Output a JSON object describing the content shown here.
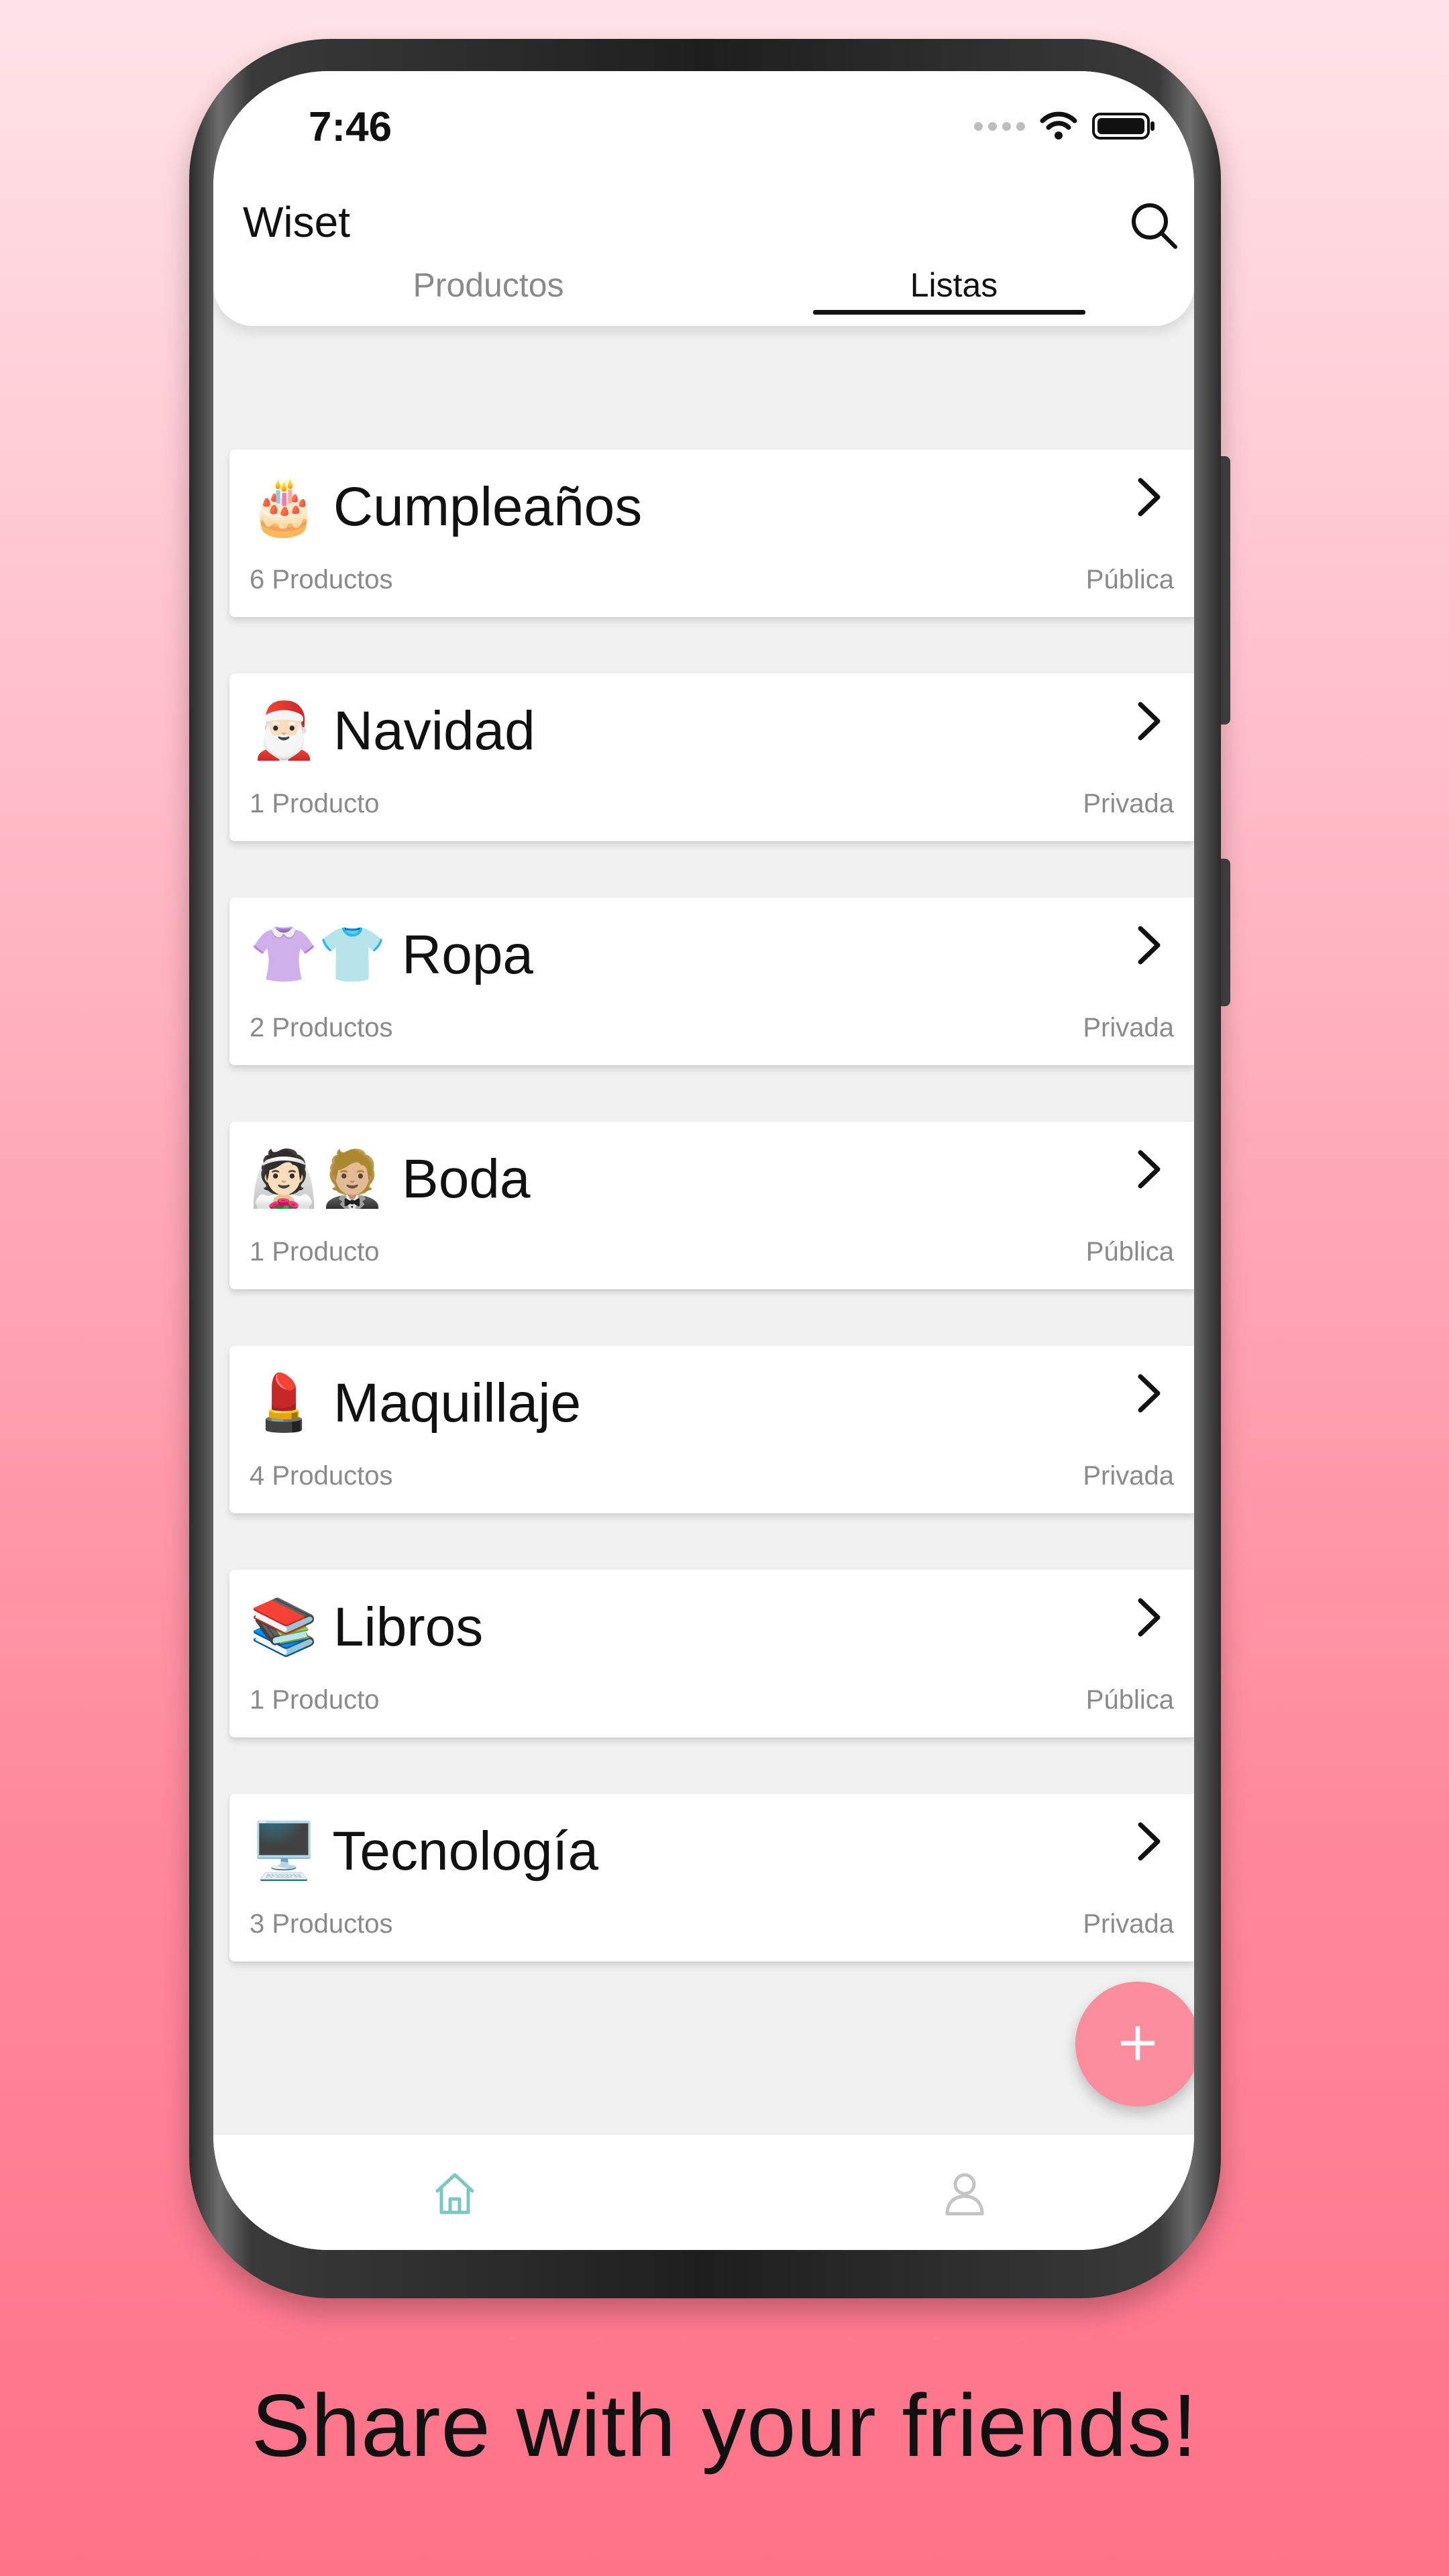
{
  "status_bar": {
    "time": "7:46"
  },
  "app": {
    "title": "Wiset",
    "tabs": [
      {
        "label": "Productos",
        "active": false
      },
      {
        "label": "Listas",
        "active": true
      }
    ]
  },
  "lists": [
    {
      "emoji": "🎂",
      "name": "Cumpleaños",
      "count": "6 Productos",
      "visibility": "Pública"
    },
    {
      "emoji": "🎅🏻",
      "name": "Navidad",
      "count": "1 Producto",
      "visibility": "Privada"
    },
    {
      "emoji": "👚👕",
      "name": "Ropa",
      "count": "2 Productos",
      "visibility": "Privada"
    },
    {
      "emoji": "👰🏻🤵🏼",
      "name": "Boda",
      "count": "1 Producto",
      "visibility": "Pública"
    },
    {
      "emoji": "💄",
      "name": "Maquillaje",
      "count": "4 Productos",
      "visibility": "Privada"
    },
    {
      "emoji": "📚",
      "name": "Libros",
      "count": "1 Producto",
      "visibility": "Pública"
    },
    {
      "emoji": "🖥️",
      "name": "Tecnología",
      "count": "3 Productos",
      "visibility": "Privada"
    }
  ],
  "fab": {
    "label": "+"
  },
  "bottom_nav": [
    {
      "icon": "home-icon",
      "active": true
    },
    {
      "icon": "user-icon",
      "active": false
    }
  ],
  "colors": {
    "accent": "#fb8d9c",
    "home_active": "#7cc6c4",
    "inactive_icon": "#c4c4c4"
  },
  "caption": "Share with your friends!"
}
